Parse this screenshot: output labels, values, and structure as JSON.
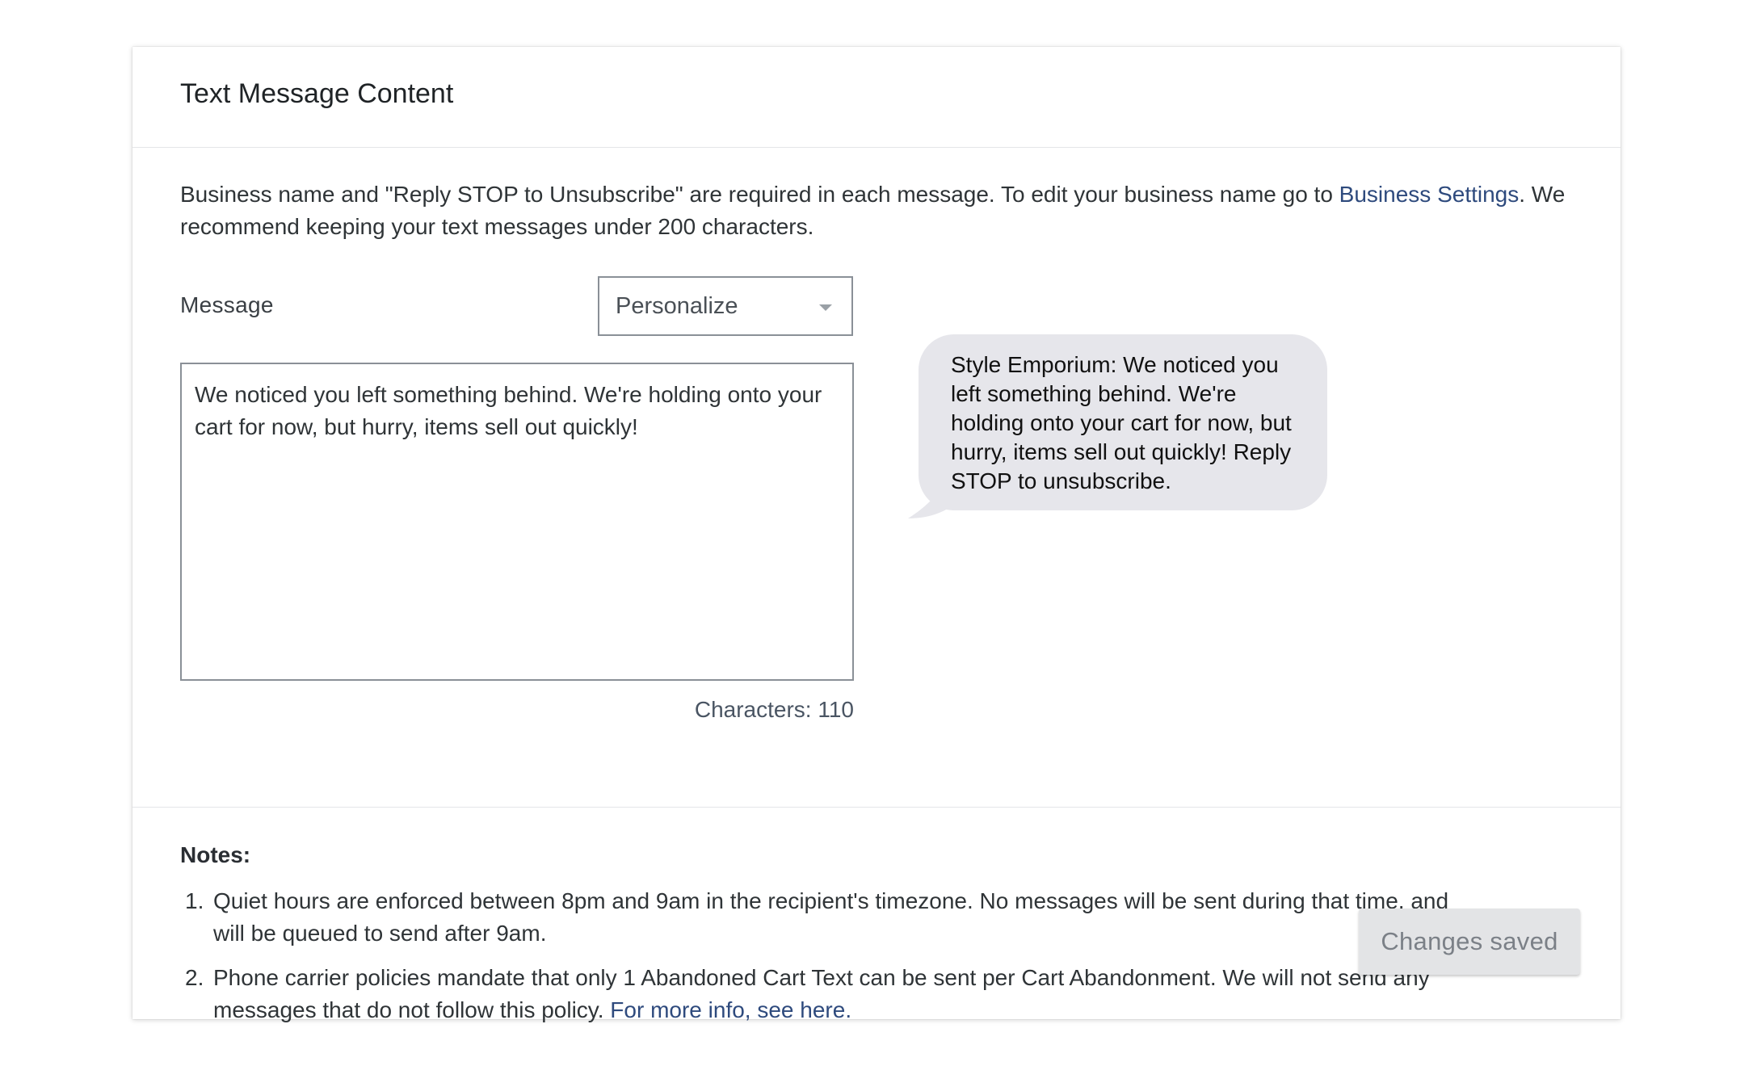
{
  "card": {
    "title": "Text Message Content"
  },
  "intro": {
    "text_before_link": "Business name and \"Reply STOP to Unsubscribe\" are required in each message. To edit your business name go to ",
    "link_label": "Business Settings",
    "text_after_link": ". We recommend keeping your text messages under 200 characters."
  },
  "message": {
    "label": "Message",
    "personalize_label": "Personalize",
    "value": "We noticed you left something behind. We're holding onto your cart for now, but hurry, items sell out quickly!",
    "characters_label": "Characters: 110"
  },
  "preview": {
    "text": "Style Emporium: We noticed you left something behind. We're holding onto your cart for now, but hurry, items sell out quickly! Reply STOP to unsubscribe."
  },
  "notes": {
    "title": "Notes:",
    "items": [
      {
        "number": "1.",
        "text": "Quiet hours are enforced between 8pm and 9am in the recipient's timezone. No messages will be sent during that time, and will be queued to send after 9am."
      },
      {
        "number": "2.",
        "text": "Phone carrier policies mandate that only 1 Abandoned Cart Text can be sent per Cart Abandonment. We will not send any messages that do not follow this policy. ",
        "link_label": "For more info, see here."
      }
    ]
  },
  "save_button": {
    "label": "Changes saved"
  },
  "colors": {
    "link": "#2e4a7d",
    "bubble": "#e6e6eb",
    "button_bg": "#e3e4e6",
    "button_text": "#7b8087"
  }
}
